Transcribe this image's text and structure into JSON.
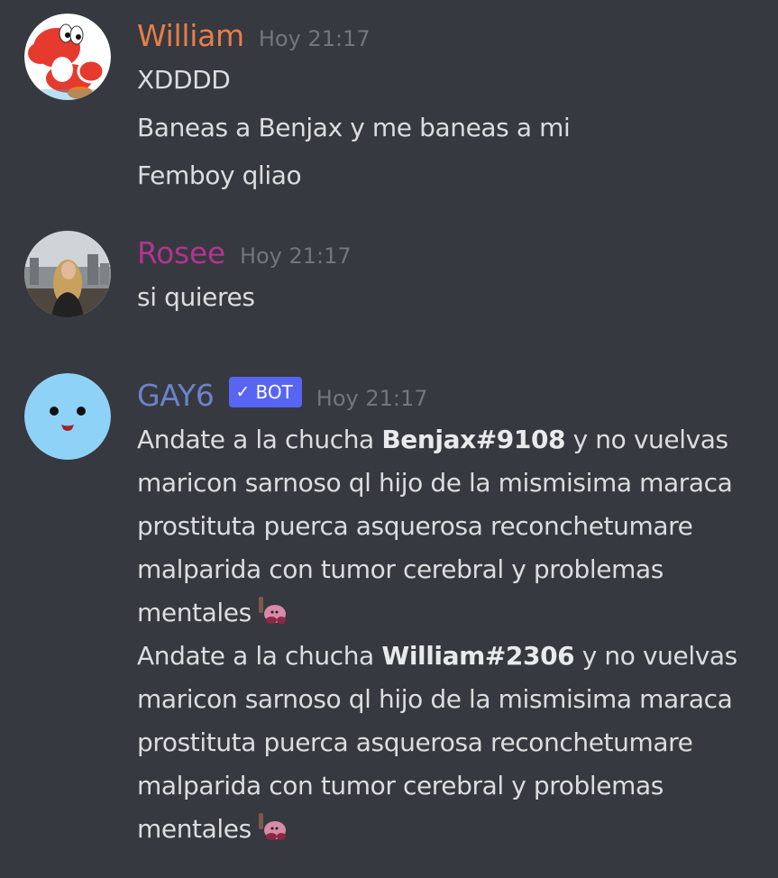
{
  "messages": [
    {
      "username": "William",
      "username_color": "#e67e4a",
      "timestamp": "Hoy 21:17",
      "avatar_icon": "yoshi-avatar",
      "lines": [
        "XDDDD",
        "Baneas a Benjax y me baneas a mi",
        "Femboy qliao"
      ]
    },
    {
      "username": "Rosee",
      "username_color": "#b3348f",
      "timestamp": "Hoy 21:17",
      "avatar_icon": "person-photo-avatar",
      "lines": [
        "si quieres"
      ]
    },
    {
      "username": "GAY6",
      "username_color": "#6c82cc",
      "bot_tag": {
        "check": "✓",
        "label": "BOT"
      },
      "timestamp": "Hoy 21:17",
      "avatar_icon": "smiley-face-avatar",
      "blocks": [
        {
          "l1_pre": "Andate a la chucha ",
          "l1_mention": "Benjax#9108",
          "l1_post": " y no vuelvas",
          "l2": "maricon sarnoso ql hijo de la mismisima maraca",
          "l3": "prostituta puerca asquerosa reconchetumare",
          "l4": "malparida con tumor cerebral y problemas",
          "l5": "mentales",
          "emoji": "kirby-emoji"
        },
        {
          "l1_pre": "Andate a la chucha ",
          "l1_mention": "William#2306",
          "l1_post": " y no vuelvas",
          "l2": "maricon sarnoso ql hijo de la mismisima maraca",
          "l3": "prostituta puerca asquerosa reconchetumare",
          "l4": "malparida con tumor cerebral y problemas",
          "l5": "mentales",
          "emoji": "kirby-emoji"
        }
      ]
    }
  ],
  "colors": {
    "background": "#36393f",
    "text": "#dcddde",
    "timestamp": "#72767d",
    "bot_tag": "#5865f2"
  }
}
